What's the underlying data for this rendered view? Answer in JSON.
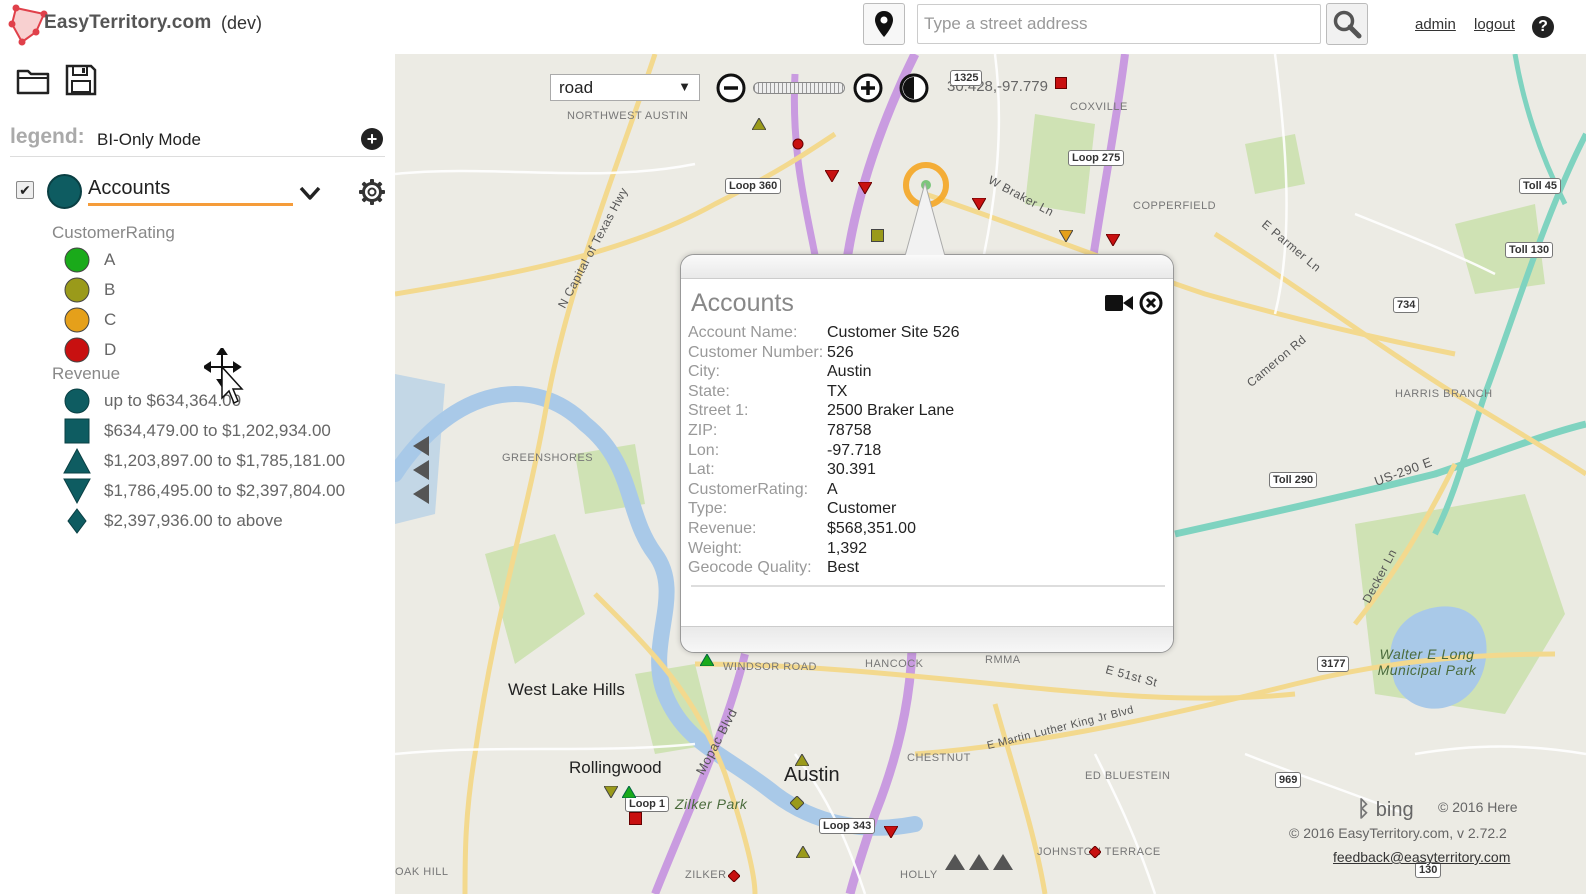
{
  "header": {
    "brand": "EasyTerritory.com",
    "env": "(dev)",
    "address_placeholder": "Type a street address",
    "admin_link": "admin",
    "logout_link": "logout",
    "help_icon": "question-circle-icon"
  },
  "panel": {
    "toolbar_icons": [
      "folder-icon",
      "save-icon"
    ],
    "legend_title": "legend:",
    "legend_mode": "BI-Only Mode",
    "layer": {
      "name": "Accounts",
      "checked": true,
      "color": "#0e5c61",
      "underline_color": "#f59c3a"
    },
    "customer_rating": {
      "title": "CustomerRating",
      "items": [
        {
          "label": "A",
          "color": "#1aaa1a"
        },
        {
          "label": "B",
          "color": "#9a9a1a"
        },
        {
          "label": "C",
          "color": "#e5a01a"
        },
        {
          "label": "D",
          "color": "#c81010"
        }
      ]
    },
    "revenue": {
      "title": "Revenue",
      "items": [
        {
          "label": "up to $634,364.00",
          "shape": "circle"
        },
        {
          "label": "$634,479.00 to $1,202,934.00",
          "shape": "square"
        },
        {
          "label": "$1,203,897.00 to $1,785,181.00",
          "shape": "triangle-up"
        },
        {
          "label": "$1,786,495.00 to $2,397,804.00",
          "shape": "triangle-down"
        },
        {
          "label": "$2,397,936.00 to above",
          "shape": "diamond"
        }
      ]
    }
  },
  "map": {
    "map_type": "road",
    "coord_readout": "30.428,-97.779",
    "labels": {
      "northwest_austin": "NORTHWEST AUSTIN",
      "coxville": "COXVILLE",
      "copperfield": "COPPERFIELD",
      "greenshores": "GREENSHORES",
      "harris_branch": "HARRIS BRANCH",
      "west_lake_hills": "West Lake Hills",
      "rollingwood": "Rollingwood",
      "austin": "Austin",
      "windsor_road": "WINDSOR ROAD",
      "hancock": "HANCOCK",
      "rmma": "RMMA",
      "chestnut": "CHESTNUT",
      "ed_bluestein": "ED BLUESTEIN",
      "johnston_terrace": "JOHNSTON TERRACE",
      "oak_hill": "OAK HILL",
      "zilker": "ZILKER",
      "holly": "HOLLY",
      "zilker_park": "Zilker Park",
      "walter_long_park": "Walter E Long Municipal Park",
      "capital_texas_hwy": "N Capital of Texas Hwy",
      "w_braker_ln": "W Braker Ln",
      "e_parmer_ln": "E Parmer Ln",
      "cameron_rd": "Cameron Rd",
      "us_290_e": "US-290 E",
      "e_51st_st": "E 51st St",
      "mlk_blvd": "E Martin Luther King Jr Blvd",
      "mopac_blvd": "Mopac Blvd",
      "decker_ln": "Decker Ln"
    },
    "shields": {
      "loop360": "Loop 360",
      "loop275": "Loop 275",
      "loop343": "Loop 343",
      "loop1": "Loop 1",
      "toll45": "Toll 45",
      "toll130a": "Toll 130",
      "toll130b": "130",
      "toll290": "Toll 290",
      "r734": "734",
      "r3177": "3177",
      "r969": "969",
      "r1325": "1325"
    }
  },
  "popup": {
    "title": "Accounts",
    "fields": [
      {
        "key": "Account Name:",
        "value": "Customer Site 526"
      },
      {
        "key": "Customer Number:",
        "value": "526"
      },
      {
        "key": "City:",
        "value": "Austin"
      },
      {
        "key": "State:",
        "value": "TX"
      },
      {
        "key": "Street 1:",
        "value": "2500 Braker Lane"
      },
      {
        "key": "ZIP:",
        "value": "78758"
      },
      {
        "key": "Lon:",
        "value": "-97.718"
      },
      {
        "key": "Lat:",
        "value": "30.391"
      },
      {
        "key": "CustomerRating:",
        "value": "A"
      },
      {
        "key": "Type:",
        "value": "Customer"
      },
      {
        "key": "Revenue:",
        "value": "$568,351.00"
      },
      {
        "key": "Weight:",
        "value": "1,392"
      },
      {
        "key": "Geocode Quality:",
        "value": "Best"
      }
    ]
  },
  "footer": {
    "bing": "bing",
    "bing_copy": "© 2016 Here",
    "app_copy": "© 2016 EasyTerritory.com, v 2.72.2",
    "feedback": "feedback@easyterritory.com"
  }
}
